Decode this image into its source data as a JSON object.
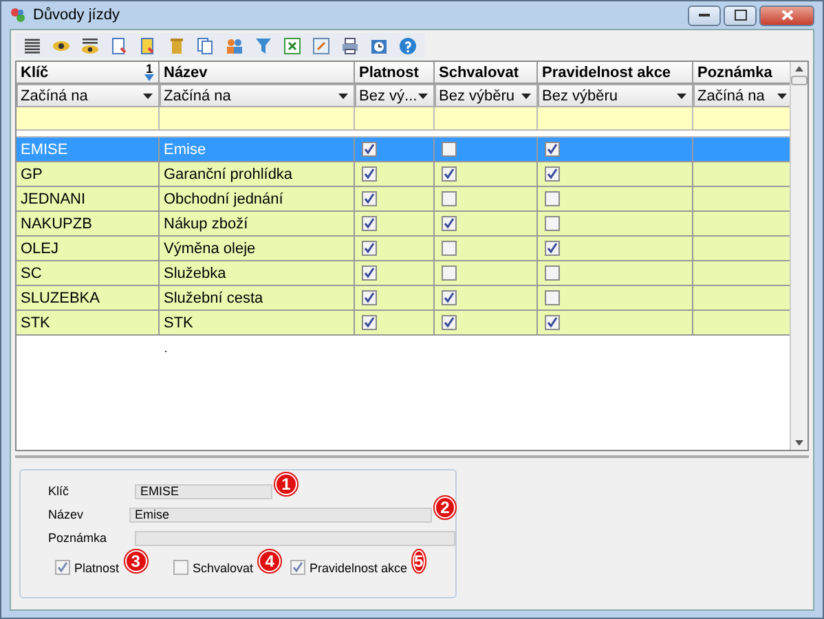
{
  "window": {
    "title": "Důvody jízdy"
  },
  "table": {
    "columns": [
      {
        "title": "Klíč",
        "filter": "Začíná na",
        "sort_order": "1"
      },
      {
        "title": "Název",
        "filter": "Začíná na"
      },
      {
        "title": "Platnost",
        "filter": "Bez vý..."
      },
      {
        "title": "Schvalovat",
        "filter": "Bez výběru"
      },
      {
        "title": "Pravidelnost akce",
        "filter": "Bez výběru"
      },
      {
        "title": "Poznámka",
        "filter": "Začíná na"
      }
    ],
    "rows": [
      {
        "key": "EMISE",
        "name": "Emise",
        "platnost": true,
        "schvalovat": false,
        "pravidelnost": true,
        "selected": true
      },
      {
        "key": "GP",
        "name": "Garanční prohlídka",
        "platnost": true,
        "schvalovat": true,
        "pravidelnost": true,
        "selected": false
      },
      {
        "key": "JEDNANI",
        "name": "Obchodní jednání",
        "platnost": true,
        "schvalovat": false,
        "pravidelnost": false,
        "selected": false
      },
      {
        "key": "NAKUPZB",
        "name": "Nákup zboží",
        "platnost": true,
        "schvalovat": true,
        "pravidelnost": false,
        "selected": false
      },
      {
        "key": "OLEJ",
        "name": "Výměna oleje",
        "platnost": true,
        "schvalovat": false,
        "pravidelnost": true,
        "selected": false
      },
      {
        "key": "SC",
        "name": "Služebka",
        "platnost": true,
        "schvalovat": false,
        "pravidelnost": false,
        "selected": false
      },
      {
        "key": "SLUZEBKA",
        "name": "Služební cesta",
        "platnost": true,
        "schvalovat": true,
        "pravidelnost": false,
        "selected": false
      },
      {
        "key": "STK",
        "name": "STK",
        "platnost": true,
        "schvalovat": true,
        "pravidelnost": true,
        "selected": false
      }
    ]
  },
  "form": {
    "fields": [
      {
        "label": "Klíč",
        "value": "EMISE",
        "marker": "1"
      },
      {
        "label": "Název",
        "value": "Emise",
        "marker": "2"
      },
      {
        "label": "Poznámka"
      }
    ],
    "checkboxes": [
      {
        "label": "Platnost",
        "checked": true,
        "marker": "3"
      },
      {
        "label": "Schvalovat",
        "checked": false,
        "marker": "4"
      },
      {
        "label": "Pravidelnost akce",
        "checked": true,
        "marker": "5"
      }
    ]
  }
}
